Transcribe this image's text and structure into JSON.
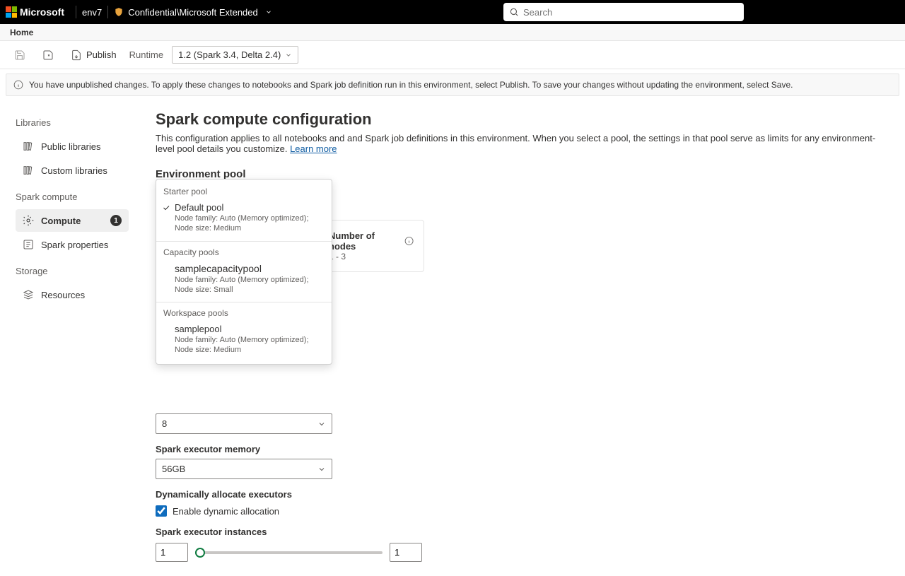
{
  "header": {
    "brand": "Microsoft",
    "env": "env7",
    "sensitivity": "Confidential\\Microsoft Extended",
    "search_placeholder": "Search"
  },
  "secondary_nav": {
    "home": "Home"
  },
  "toolbar": {
    "publish": "Publish",
    "runtime_label": "Runtime",
    "runtime_value": "1.2 (Spark 3.4, Delta 2.4)"
  },
  "info_bar": "You have unpublished changes. To apply these changes to notebooks and Spark job definition run in this environment, select Publish. To save your changes without updating the environment, select Save.",
  "sidebar": {
    "sections": [
      {
        "title": "Libraries",
        "items": [
          {
            "label": "Public libraries"
          },
          {
            "label": "Custom libraries"
          }
        ]
      },
      {
        "title": "Spark compute",
        "items": [
          {
            "label": "Compute",
            "badge": "1",
            "active": true
          },
          {
            "label": "Spark properties"
          }
        ]
      },
      {
        "title": "Storage",
        "items": [
          {
            "label": "Resources"
          }
        ]
      }
    ]
  },
  "content": {
    "title": "Spark compute configuration",
    "description": "This configuration applies to all notebooks and and Spark job definitions in this environment. When you select a pool, the settings in that pool serve as limits for any environment-level pool details you customize.",
    "learn_more": "Learn more",
    "env_pool_title": "Environment pool",
    "pool_select_value": "Default pool",
    "dropdown": {
      "group1_label": "Starter pool",
      "option1_title": "Default pool",
      "option1_sub": "Node family: Auto (Memory optimized); Node size: Medium",
      "group2_label": "Capacity pools",
      "option2_title": "samplecapacitypool",
      "option2_sub": "Node family: Auto (Memory optimized); Node size: Small",
      "group3_label": "Workspace pools",
      "option3_title": "samplepool",
      "option3_sub": "Node family: Auto (Memory optimized); Node size: Medium"
    },
    "card": {
      "num_nodes_label": "Number of nodes",
      "num_nodes_value": "1 - 3"
    },
    "cores_value": "8",
    "exec_mem_label": "Spark executor memory",
    "exec_mem_value": "56GB",
    "dyn_alloc_label": "Dynamically allocate executors",
    "dyn_alloc_checkbox": "Enable dynamic allocation",
    "exec_instances_label": "Spark executor instances",
    "exec_min": "1",
    "exec_max": "1"
  }
}
